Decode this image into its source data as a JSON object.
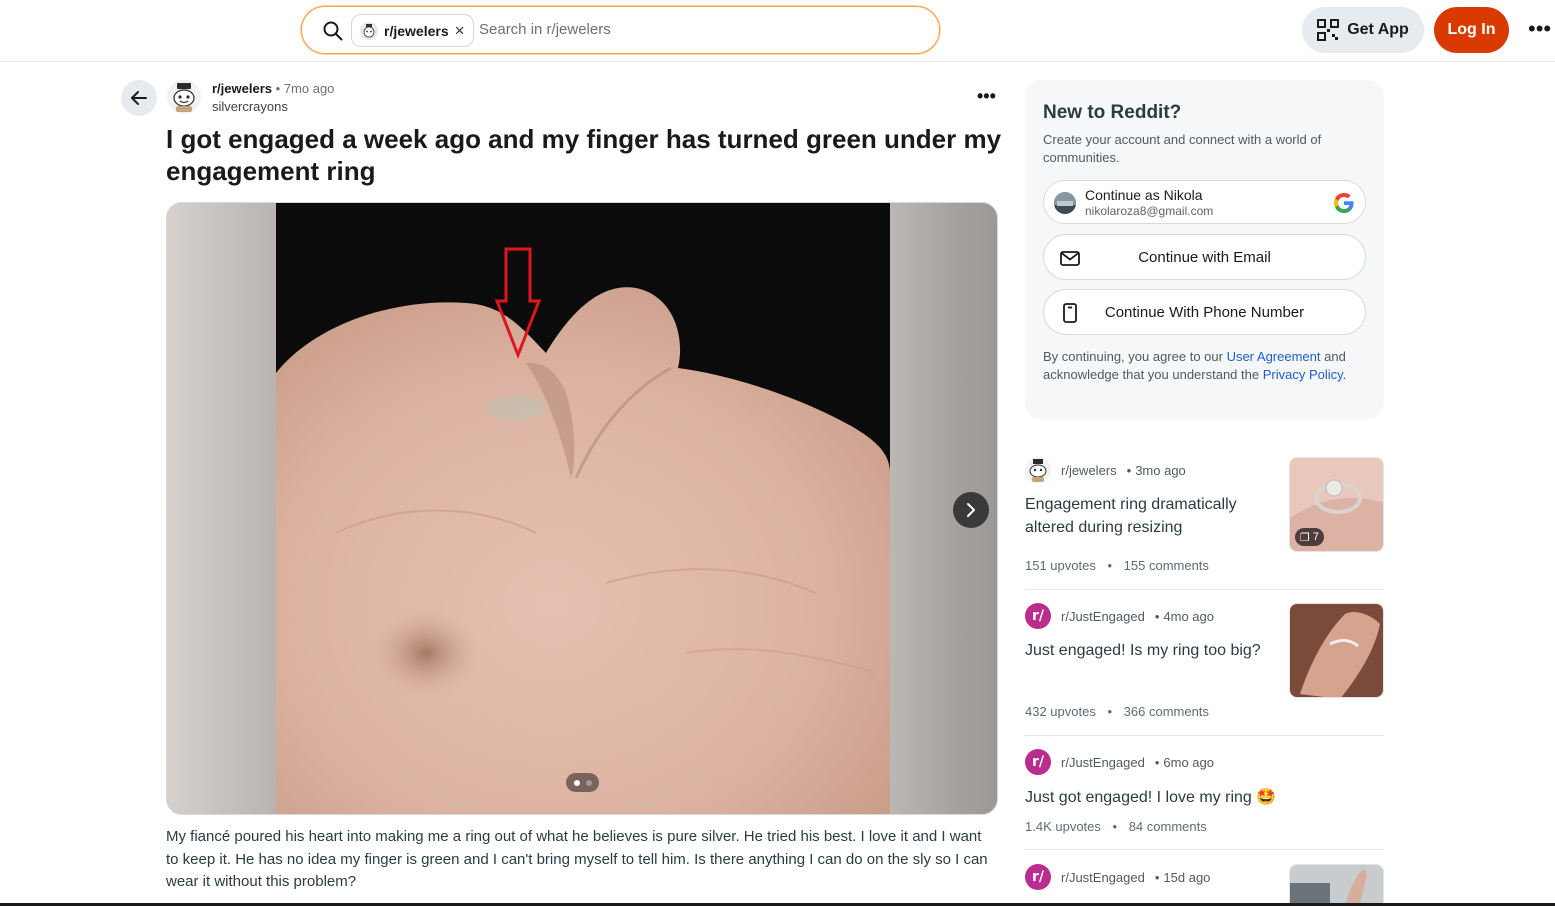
{
  "header": {
    "search_chip": "r/jewelers",
    "search_placeholder": "Search in r/jewelers",
    "get_app_label": "Get App",
    "login_label": "Log In",
    "more_label": "•••"
  },
  "post": {
    "subreddit": "r/jewelers",
    "separator": "•",
    "time": "7mo ago",
    "author": "silvercrayons",
    "options_label": "•••",
    "title": "I got engaged a week ago and my finger has turned green under my engagement ring",
    "body": "My fiancé poured his heart into making me a ring out of what he believes is pure silver. He tried his best. I love it and I want to keep it. He has no idea my finger is green and I can't bring myself to tell him. Is there anything I can do on the sly so I can wear it without this problem?",
    "media": {
      "current_slide": 1,
      "total_slides": 2
    }
  },
  "signup": {
    "title": "New to Reddit?",
    "subtitle": "Create your account and connect with a world of communities.",
    "google_name": "Continue as Nikola",
    "google_email": "nikolaroza8@gmail.com",
    "email_label": "Continue with Email",
    "phone_label": "Continue With Phone Number",
    "legal_prefix": "By continuing, you agree to our ",
    "legal_link1": "User Agreement",
    "legal_middle": " and acknowledge that you understand the ",
    "legal_link2": "Privacy Policy",
    "legal_suffix": "."
  },
  "related": [
    {
      "subreddit": "r/jewelers",
      "time": "3mo ago",
      "title": "Engagement ring dramatically altered during resizing",
      "upvotes": "151 upvotes",
      "comments": "155 comments",
      "gallery_count": "7"
    },
    {
      "subreddit": "r/JustEngaged",
      "time": "4mo ago",
      "title": "Just engaged! Is my ring too big?",
      "upvotes": "432 upvotes",
      "comments": "366 comments"
    },
    {
      "subreddit": "r/JustEngaged",
      "time": "6mo ago",
      "title": "Just got engaged! I love my ring 🤩",
      "upvotes": "1.4K upvotes",
      "comments": "84 comments"
    },
    {
      "subreddit": "r/JustEngaged",
      "time": "15d ago"
    }
  ],
  "colors": {
    "brand_orange": "#d93a00",
    "link_blue": "#1d5fcc",
    "annotation_red": "#e0161e"
  }
}
